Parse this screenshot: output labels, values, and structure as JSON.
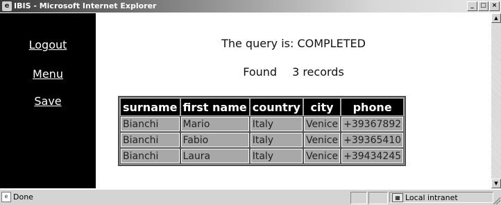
{
  "window": {
    "title": "IBIS - Microsoft Internet Explorer",
    "ie_icon": "ie-logo-icon",
    "buttons": [
      "_",
      "□",
      "×"
    ]
  },
  "sidebar": {
    "links": [
      {
        "label": "Logout"
      },
      {
        "label": "Menu"
      },
      {
        "label": "Save"
      }
    ]
  },
  "main": {
    "query_status": "The query is: COMPLETED",
    "found_label": "Found",
    "found_count": "3 records",
    "table": {
      "headers": [
        "surname",
        "first name",
        "country",
        "city",
        "phone"
      ],
      "rows": [
        [
          "Bianchi",
          "Mario",
          "Italy",
          "Venice",
          "+39367892"
        ],
        [
          "Bianchi",
          "Fabio",
          "Italy",
          "Venice",
          "+39365410"
        ],
        [
          "Bianchi",
          "Laura",
          "Italy",
          "Venice",
          "+39434245"
        ]
      ]
    }
  },
  "statusbar": {
    "status_text": "Done",
    "zone_text": "Local intranet"
  },
  "colors": {
    "sidebar_bg": "#000000",
    "header_bg": "#000000",
    "cell_bg": "#a8a8a8"
  }
}
